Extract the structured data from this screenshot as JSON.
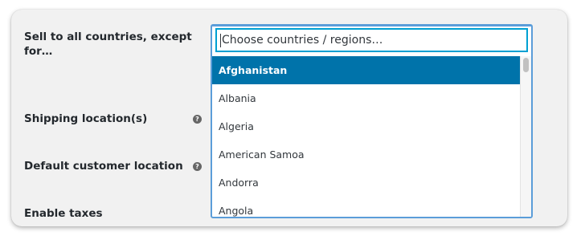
{
  "settings": {
    "sell_to_label": "Sell to all countries, except for…",
    "shipping_label": "Shipping location(s)",
    "default_location_label": "Default customer location",
    "enable_taxes_label": "Enable taxes",
    "help_glyph": "?"
  },
  "country_select": {
    "placeholder": "Choose countries / regions…",
    "options": [
      {
        "label": "Afghanistan",
        "highlighted": true
      },
      {
        "label": "Albania",
        "highlighted": false
      },
      {
        "label": "Algeria",
        "highlighted": false
      },
      {
        "label": "American Samoa",
        "highlighted": false
      },
      {
        "label": "Andorra",
        "highlighted": false
      },
      {
        "label": "Angola",
        "highlighted": false
      }
    ]
  },
  "colors": {
    "highlight": "#0073aa",
    "focus_border": "#00a0d2",
    "panel_background": "#f1f1f1",
    "label_text": "#23282d"
  }
}
